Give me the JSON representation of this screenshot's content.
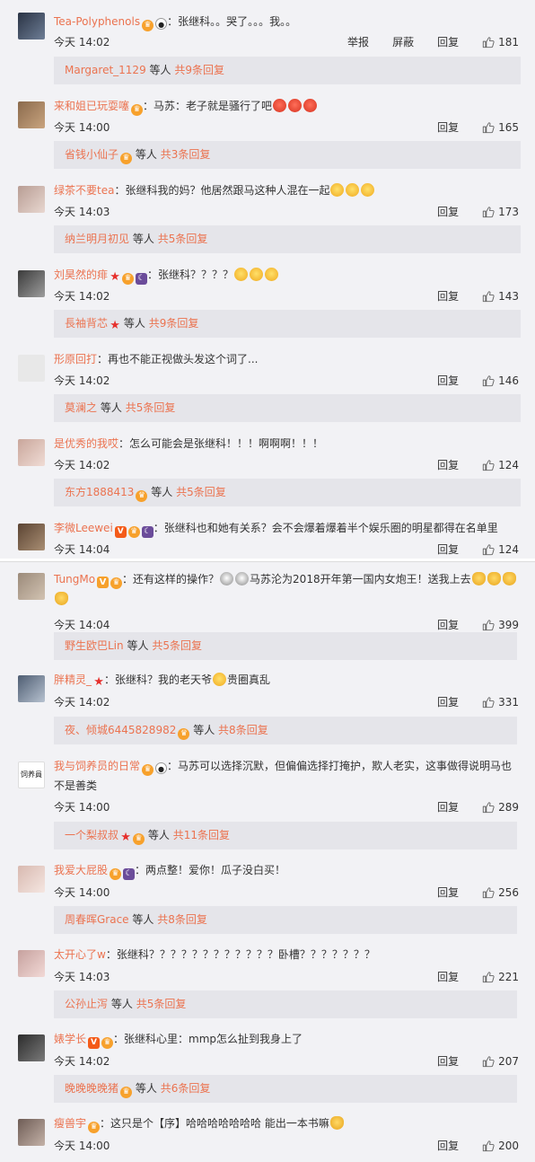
{
  "ui": {
    "report": "举报",
    "block": "屏蔽",
    "reply": "回复",
    "reply_suffix_people": "等人",
    "reply_total_prefix": "共",
    "reply_total_suffix": "条回复"
  },
  "comments_a": [
    {
      "user": "Tea-Polyphenols",
      "text_a": "：张继科。。哭了。。。我。。",
      "text_b": "",
      "time": "今天 14:02",
      "likes": "181",
      "reply_user": "Margaret_1129",
      "reply_count": "9",
      "has_report": true
    },
    {
      "user": "来和姐已玩耍噻",
      "text_a": "：马苏：老子就是骚行了吧",
      "text_b": "",
      "time": "今天 14:00",
      "likes": "165",
      "reply_user": "省钱小仙子",
      "reply_count": "3"
    },
    {
      "user": "绿茶不要tea",
      "text_a": "：张继科我的妈？他居然跟马这种人混在一起",
      "text_b": "",
      "time": "今天 14:03",
      "likes": "173",
      "reply_user": "纳兰明月初见",
      "reply_count": "5"
    },
    {
      "user": "刘昊然的痱",
      "text_a": "：张继科？？？？",
      "text_b": "",
      "time": "今天 14:02",
      "likes": "143",
      "reply_user": "長袖背芯",
      "reply_count": "9"
    },
    {
      "user": "形原回打",
      "text_a": "：再也不能正视做头发这个词了...",
      "text_b": "",
      "time": "今天 14:02",
      "likes": "146",
      "reply_user": "莫澜之",
      "reply_count": "5"
    },
    {
      "user": "是优秀的我哎",
      "text_a": "：怎么可能会是张继科！！！啊啊啊！！！",
      "text_b": "",
      "time": "今天 14:02",
      "likes": "124",
      "reply_user": "东方1888413",
      "reply_count": "5"
    },
    {
      "user": "李微Leewei",
      "text_a": "：张继科也和她有关系？会不会爆着爆着半个娱乐圈的明星都得在名单里",
      "text_b": "",
      "time": "今天 14:04",
      "likes": "124",
      "reply_user": "",
      "reply_count": ""
    }
  ],
  "comments_b": [
    {
      "user": "TungMo",
      "text_a": "：还有这样的操作？",
      "text_b": "马苏沦为2018开年第一国内女炮王！送我上去",
      "time": "今天 14:04",
      "likes": "399",
      "reply_user": "野生欧巴Lin",
      "reply_count": "5"
    },
    {
      "user": "胖精灵_",
      "text_a": "：张继科？我的老天爷",
      "text_b": "贵圈真乱",
      "time": "今天 14:02",
      "likes": "331",
      "reply_user": "夜、倾城6445828982",
      "reply_count": "8"
    },
    {
      "user": "我与饲养员的日常",
      "text_a": "：马苏可以选择沉默，但偏偏选择打掩护，欺人老实，这事做得说明马也不是善类",
      "text_b": "",
      "time": "今天 14:00",
      "likes": "289",
      "reply_user": "一个梨叔叔",
      "reply_count": "11"
    },
    {
      "user": "我爱大屁股",
      "text_a": "：两点整！爱你！瓜子没白买！",
      "text_b": "",
      "time": "今天 14:00",
      "likes": "256",
      "reply_user": "周春晖Grace",
      "reply_count": "8"
    },
    {
      "user": "太开心了w",
      "text_a": "：张继科？？？？？？？？？？？？卧槽？？？？？？？",
      "text_b": "",
      "time": "今天 14:03",
      "likes": "221",
      "reply_user": "公孙止泻",
      "reply_count": "5"
    },
    {
      "user": "婊学长",
      "text_a": "：张继科心里：mmp怎么扯到我身上了",
      "text_b": "",
      "time": "今天 14:02",
      "likes": "207",
      "reply_user": "晚晚晚晚猪",
      "reply_count": "6"
    },
    {
      "user": "瘦兽宇",
      "text_a": "：这只是个【序】哈哈哈哈哈哈哈 能出一本书嘛",
      "text_b": "",
      "time": "今天 14:00",
      "likes": "200",
      "reply_user": "",
      "reply_count": ""
    }
  ],
  "avatar_text": "饲养員"
}
